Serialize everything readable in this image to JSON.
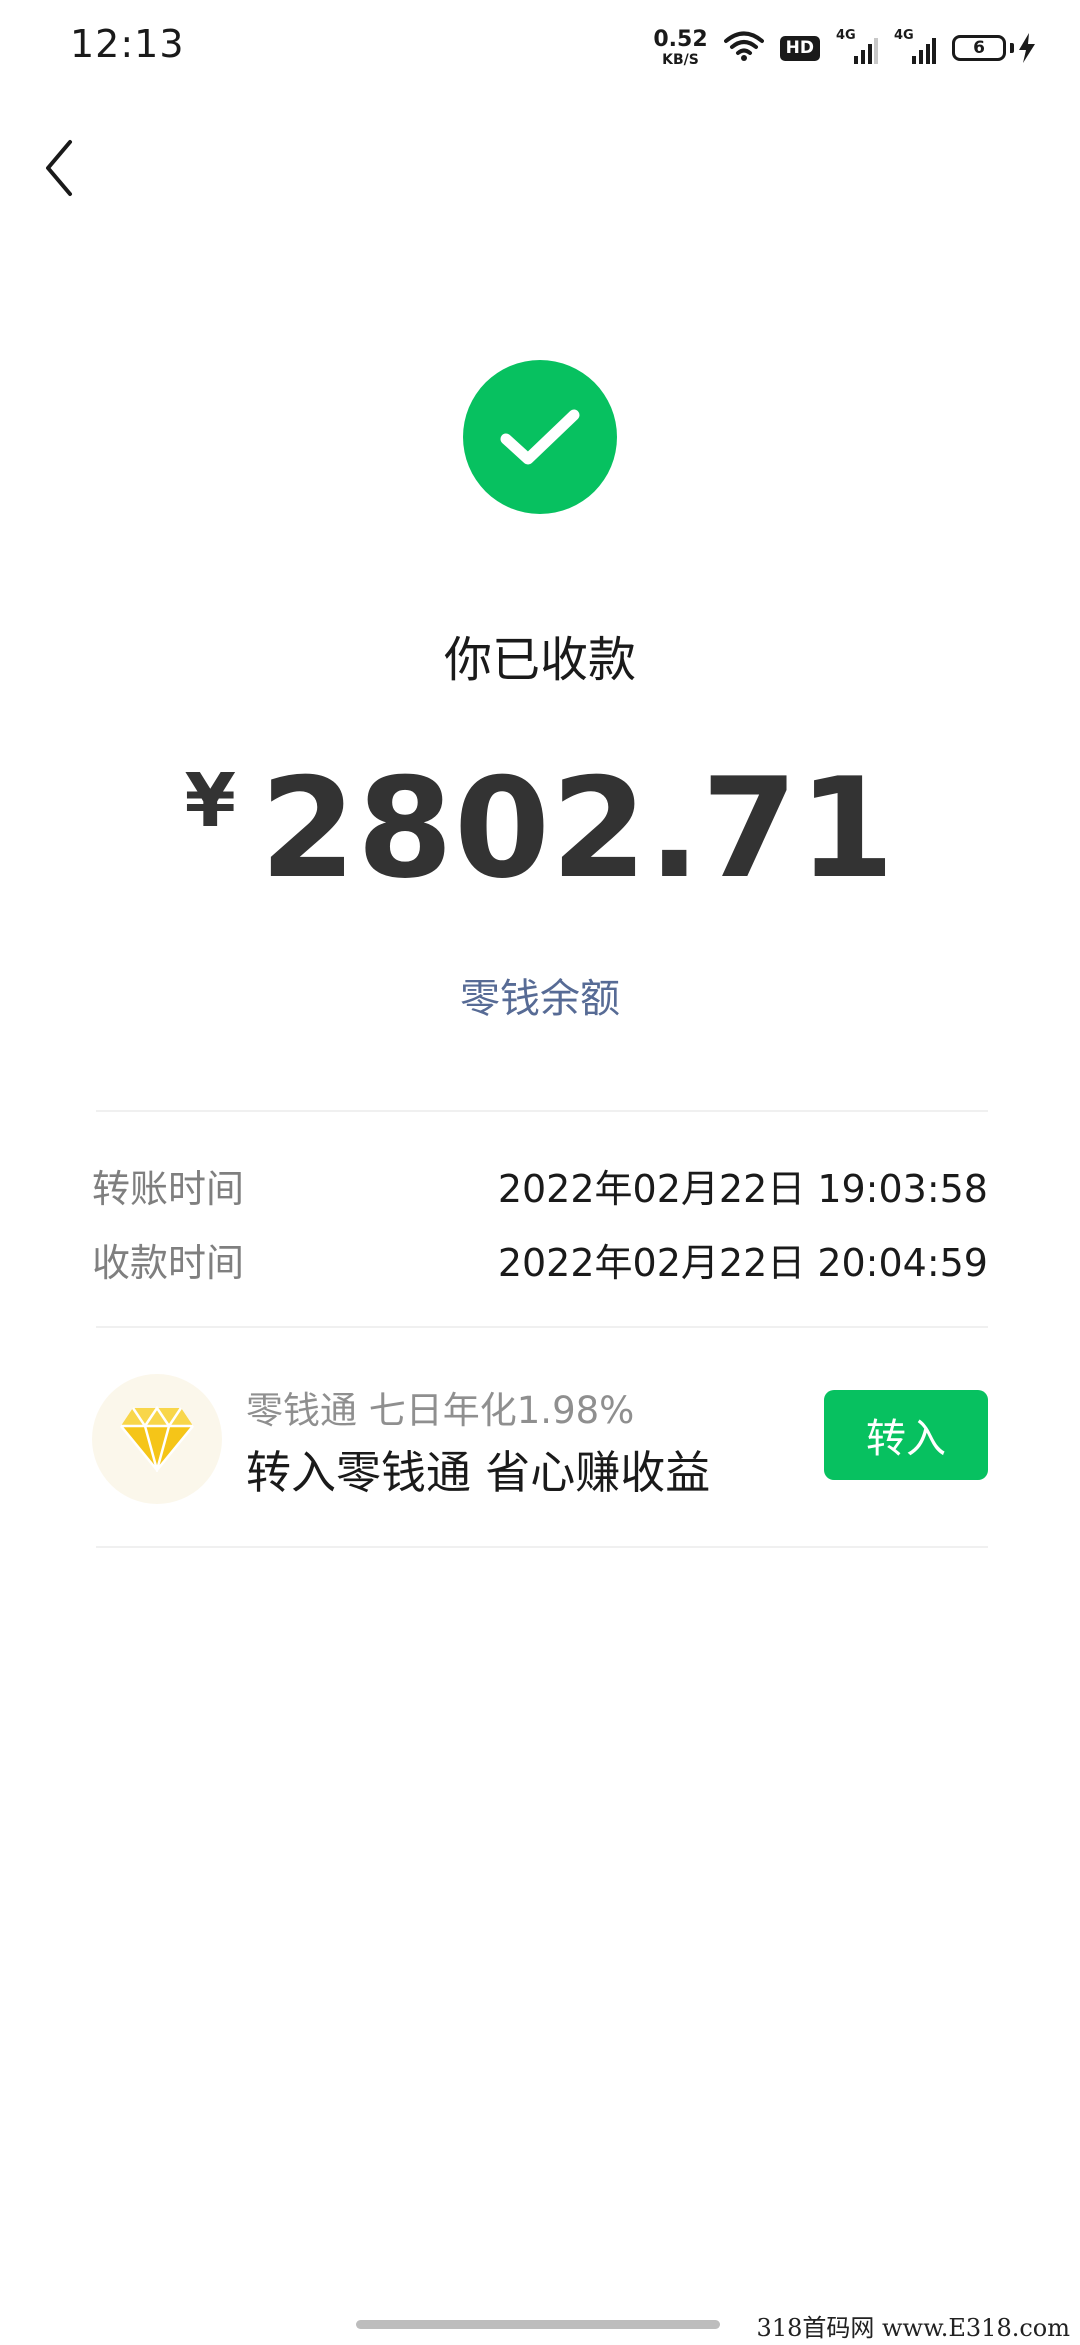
{
  "status_bar": {
    "time": "12:13",
    "net_speed_value": "0.52",
    "net_speed_unit": "KB/S",
    "hd_label": "HD",
    "sim1_label": "4G",
    "sim2_label": "4G",
    "battery_level": "6"
  },
  "icons": {
    "back": "chevron-left-icon",
    "success": "check-circle-icon",
    "promo": "diamond-icon"
  },
  "result": {
    "title": "你已收款",
    "currency": "¥",
    "amount": "2802.71",
    "balance_link": "零钱余额"
  },
  "details": [
    {
      "label": "转账时间",
      "value": "2022年02月22日 19:03:58"
    },
    {
      "label": "收款时间",
      "value": "2022年02月22日 20:04:59"
    }
  ],
  "promo": {
    "subtitle": "零钱通 七日年化1.98%",
    "title": "转入零钱通 省心赚收益",
    "button_label": "转入"
  },
  "watermark": "318首码网 www.E318.com",
  "colors": {
    "accent_green": "#07c160",
    "link_blue": "#576b95",
    "diamond_gold": "#f5c518"
  }
}
